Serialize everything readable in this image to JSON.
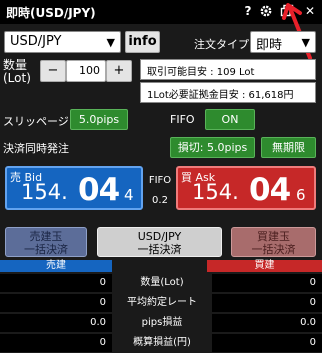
{
  "window": {
    "title": "即時(USD/JPY)"
  },
  "titlebar_icons": [
    "help-icon",
    "gear-icon",
    "restore-icon",
    "close-icon"
  ],
  "titlebar_glyphs": {
    "help": "?",
    "close": "✕"
  },
  "symbol_select": {
    "value": "USD/JPY"
  },
  "info_button": {
    "label": "info"
  },
  "order_type": {
    "label": "注文タイプ",
    "value": "即時"
  },
  "quantity": {
    "label": "数量\n(Lot)",
    "minus": "−",
    "value": "100",
    "plus": "+"
  },
  "available": "取引可能目安 : 109 Lot",
  "margin_required": "1Lot必要証拠金目安 : 61,618円",
  "slippage": {
    "label": "スリッページ",
    "value": "5.0pips"
  },
  "fifo": {
    "label": "FIFO",
    "value": "ON"
  },
  "simultaneous_settlement": {
    "label": "決済同時発注",
    "stop": "損切: 5.0pips",
    "limit": "無期限"
  },
  "bid": {
    "label": "売 Bid",
    "price_prefix": "154.",
    "price_main": "04",
    "price_last": "4"
  },
  "ask": {
    "label": "買 Ask",
    "price_prefix": "154.",
    "price_main": "04",
    "price_last": "6"
  },
  "spread": {
    "label": "FIFO",
    "value": "0.2"
  },
  "settle_buttons": {
    "sell": "売建玉\n一括決済",
    "pair": "USD/JPY\n一括決済",
    "buy": "買建玉\n一括決済"
  },
  "positions": {
    "sell_header": "売建",
    "buy_header": "買建",
    "rows": [
      {
        "label": "数量(Lot)",
        "sell": "0",
        "buy": "0"
      },
      {
        "label": "平均約定レート",
        "sell": "0",
        "buy": "0"
      },
      {
        "label": "pips損益",
        "sell": "0.0",
        "buy": "0.0"
      },
      {
        "label": "概算損益(円)",
        "sell": "0",
        "buy": "0"
      }
    ]
  },
  "colors": {
    "bid": "#1565c0",
    "ask": "#c62828",
    "green": "#2e8b2e",
    "annotation_arrow": "#e8202a"
  }
}
